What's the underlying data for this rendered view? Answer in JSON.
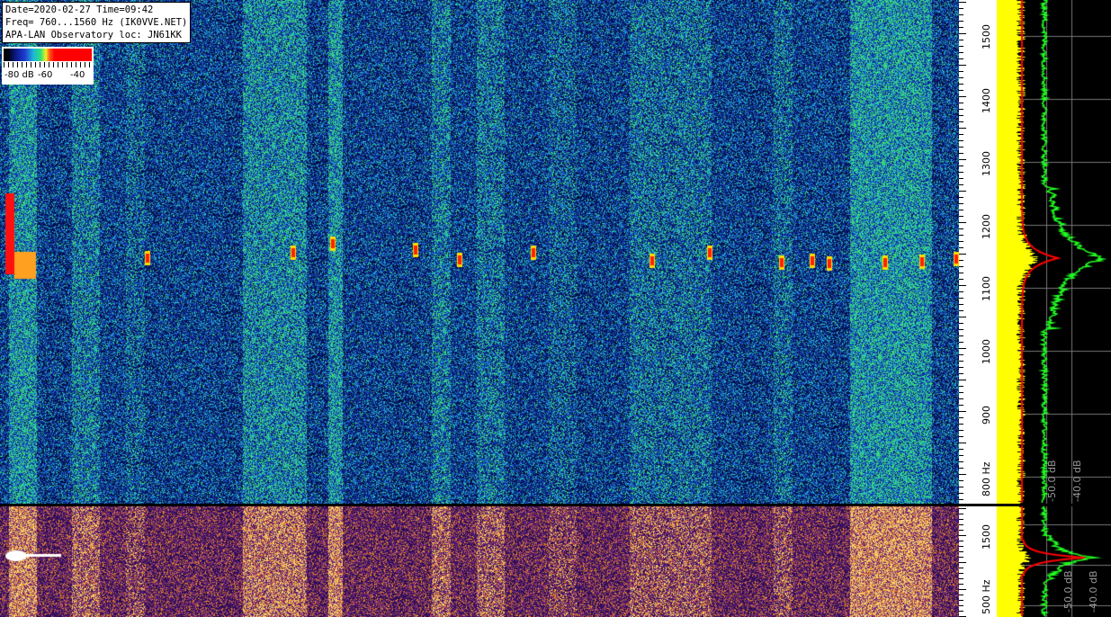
{
  "info": {
    "line1": "Date=2020-02-27 Time=09:42",
    "line2": "Freq= 760...1560 Hz (IK0VVE.NET)",
    "line3": "APA-LAN Observatory loc: JN61KK"
  },
  "legend": {
    "label_a": "-80 dB",
    "label_b": "-60",
    "label_c": "-40"
  },
  "scale_top": {
    "labels": [
      "1500",
      "1400",
      "1300",
      "1200",
      "1100",
      "1000",
      "900",
      "800 Hz"
    ]
  },
  "scale_bottom": {
    "labels": [
      "1500",
      "500 Hz"
    ]
  },
  "spectrum_top": {
    "db_labels": [
      "-50.0 dB",
      "-40.0 dB"
    ]
  },
  "spectrum_bottom": {
    "db_labels": [
      "-50.0 dB",
      "-40.0 dB"
    ]
  },
  "colors": {
    "waterfall_bg": "#06206e",
    "spectrum_yellow": "#ffff00",
    "spectrum_green": "#22ff22",
    "spectrum_red": "#ff0000"
  }
}
